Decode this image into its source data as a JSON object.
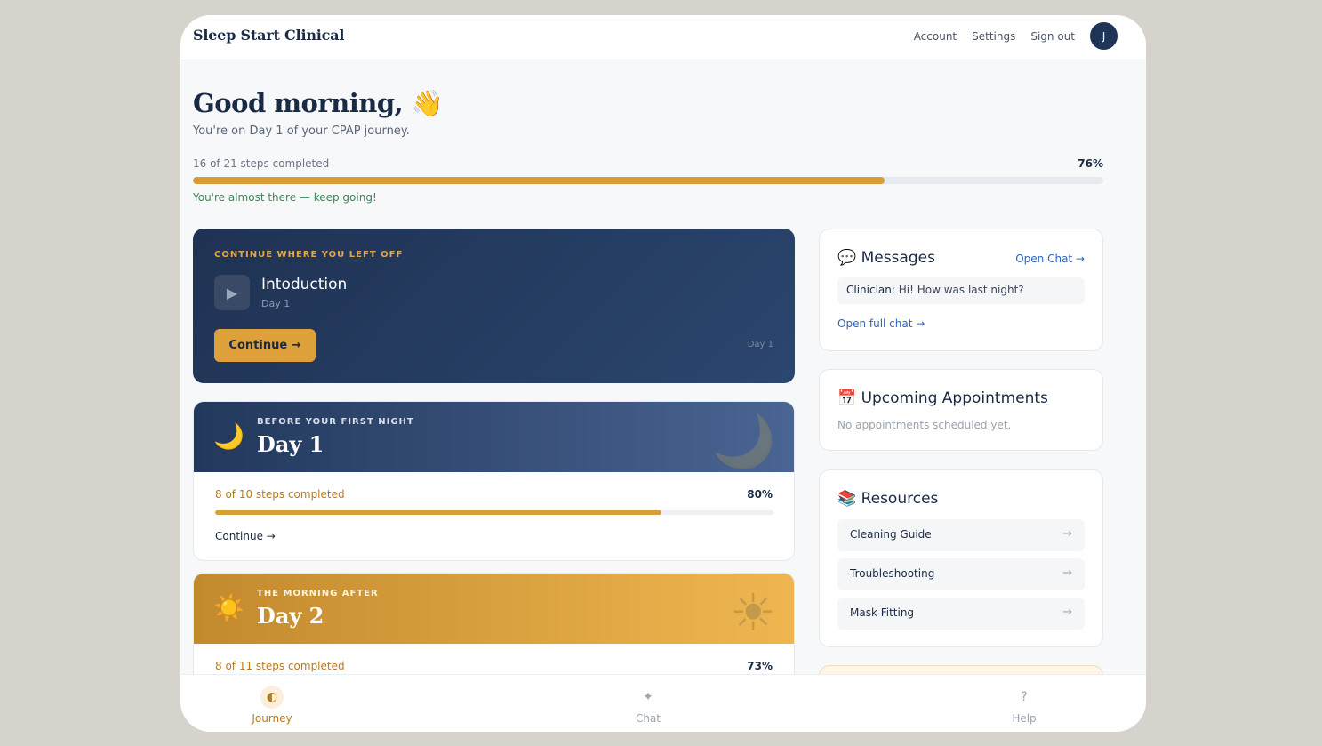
{
  "header": {
    "brand": "Sleep Start Clinical",
    "nav": [
      "Account",
      "Settings",
      "Sign out"
    ],
    "avatar_initial": "J"
  },
  "greeting": {
    "title": "Good morning, 👋",
    "subtitle": "You're on Day 1 of your CPAP journey."
  },
  "overall_progress": {
    "label": "16 of 21 steps completed",
    "percent_label": "76%",
    "percent": 76,
    "message": "You're almost there — keep going!"
  },
  "continue_card": {
    "eyebrow": "CONTINUE WHERE YOU LEFT OFF",
    "play_icon": "▶",
    "title": "Intoduction",
    "subtitle": "Day 1",
    "button_label": "Continue →",
    "day_label": "Day 1"
  },
  "days": [
    {
      "emoji": "🌙",
      "deco": "🌙",
      "eyebrow": "BEFORE YOUR FIRST NIGHT",
      "title": "Day 1",
      "progress_label": "8 of 10 steps completed",
      "percent_label": "80%",
      "percent": 80,
      "link": "Continue →"
    },
    {
      "emoji": "☀️",
      "deco": "☀",
      "eyebrow": "THE MORNING AFTER",
      "title": "Day 2",
      "progress_label": "8 of 11 steps completed",
      "percent_label": "73%",
      "percent": 73
    }
  ],
  "messages": {
    "title": "💬 Messages",
    "open_chat": "Open Chat →",
    "sender": "Clinician:",
    "text": " Hi! How was last night?",
    "open_full": "Open full chat →"
  },
  "appointments": {
    "title": "📅 Upcoming Appointments",
    "empty": "No appointments scheduled yet."
  },
  "resources": {
    "title": "📚 Resources",
    "items": [
      "Cleaning Guide",
      "Troubleshooting",
      "Mask Fitting"
    ],
    "arrow": "→"
  },
  "tabs": [
    {
      "label": "Journey",
      "icon": "◐",
      "icon_name": "journey-icon"
    },
    {
      "label": "Chat",
      "icon": "✦",
      "icon_name": "chat-icon"
    },
    {
      "label": "Help",
      "icon": "?",
      "icon_name": "help-icon"
    }
  ],
  "colors": {
    "accent": "#d89d36",
    "navy": "#1f3558",
    "link": "#2e63c4",
    "success": "#3a8a5a"
  }
}
